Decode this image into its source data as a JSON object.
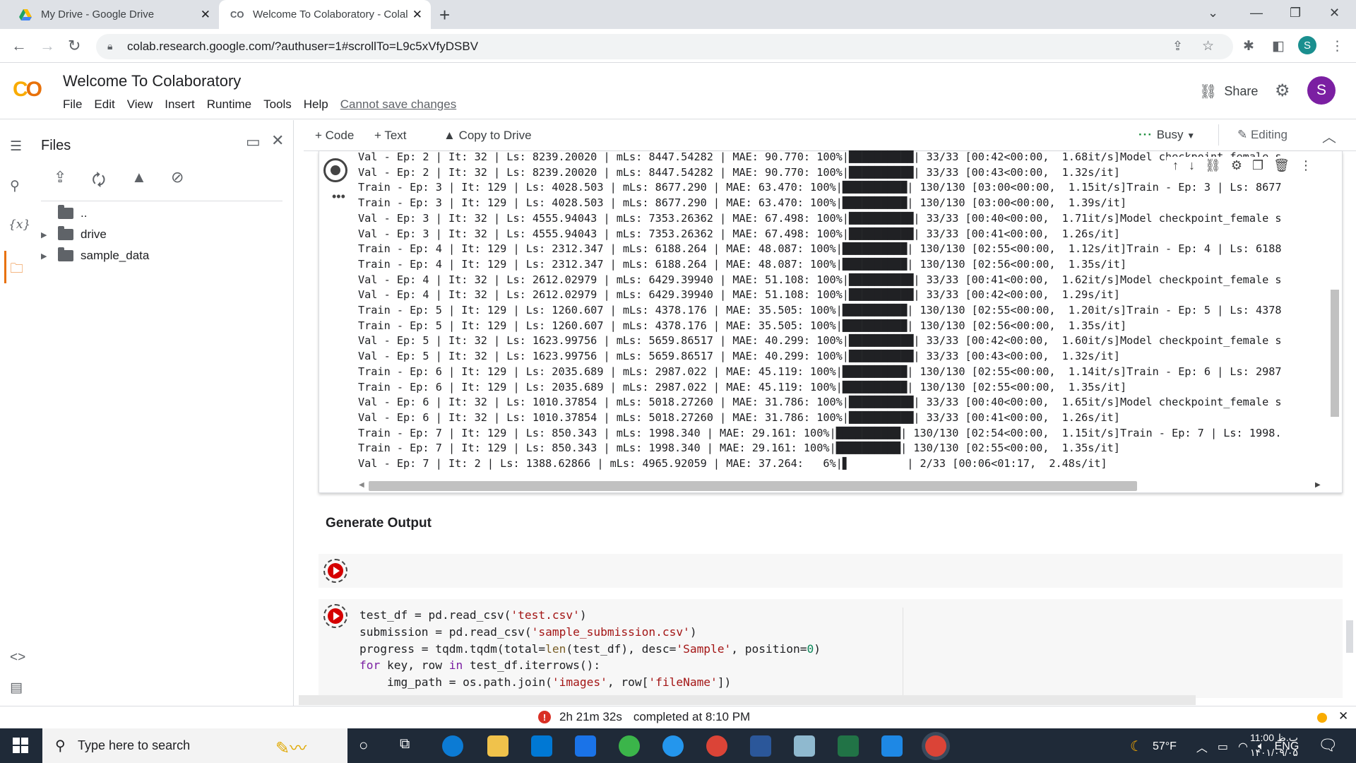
{
  "browser": {
    "tabs": [
      {
        "title": "My Drive - Google Drive",
        "icon": "google-drive-icon"
      },
      {
        "title": "Welcome To Colaboratory - Colal",
        "icon": "colab-icon"
      }
    ],
    "url": "colab.research.google.com/?authuser=1#scrollTo=L9c5xVfyDSBV",
    "profile_initial": "S"
  },
  "colab": {
    "logo": "CO",
    "title": "Welcome To Colaboratory",
    "menu": [
      "File",
      "Edit",
      "View",
      "Insert",
      "Runtime",
      "Tools",
      "Help"
    ],
    "cannot_save": "Cannot save changes",
    "share_label": "Share",
    "avatar_initial": "S"
  },
  "files": {
    "title": "Files",
    "parent": "..",
    "items": [
      "drive",
      "sample_data"
    ]
  },
  "toolbar": {
    "code": "+ Code",
    "text": "+ Text",
    "copy": "Copy to Drive",
    "busy": "Busy",
    "editing": "Editing"
  },
  "output": {
    "lines": [
      "Val - Ep: 2 | It: 32 | Ls: 8239.20020 | mLs: 8447.54282 | MAE: 90.770: 100%|██████████| 33/33 [00:42<00:00,  1.68it/s]Model checkpoint_female s",
      "Val - Ep: 2 | It: 32 | Ls: 8239.20020 | mLs: 8447.54282 | MAE: 90.770: 100%|██████████| 33/33 [00:43<00:00,  1.32s/it]",
      "Train - Ep: 3 | It: 129 | Ls: 4028.503 | mLs: 8677.290 | MAE: 63.470: 100%|██████████| 130/130 [03:00<00:00,  1.15it/s]Train - Ep: 3 | Ls: 8677",
      "Train - Ep: 3 | It: 129 | Ls: 4028.503 | mLs: 8677.290 | MAE: 63.470: 100%|██████████| 130/130 [03:00<00:00,  1.39s/it]",
      "Val - Ep: 3 | It: 32 | Ls: 4555.94043 | mLs: 7353.26362 | MAE: 67.498: 100%|██████████| 33/33 [00:40<00:00,  1.71it/s]Model checkpoint_female s",
      "Val - Ep: 3 | It: 32 | Ls: 4555.94043 | mLs: 7353.26362 | MAE: 67.498: 100%|██████████| 33/33 [00:41<00:00,  1.26s/it]",
      "Train - Ep: 4 | It: 129 | Ls: 2312.347 | mLs: 6188.264 | MAE: 48.087: 100%|██████████| 130/130 [02:55<00:00,  1.12s/it]Train - Ep: 4 | Ls: 6188",
      "Train - Ep: 4 | It: 129 | Ls: 2312.347 | mLs: 6188.264 | MAE: 48.087: 100%|██████████| 130/130 [02:56<00:00,  1.35s/it]",
      "Val - Ep: 4 | It: 32 | Ls: 2612.02979 | mLs: 6429.39940 | MAE: 51.108: 100%|██████████| 33/33 [00:41<00:00,  1.62it/s]Model checkpoint_female s",
      "Val - Ep: 4 | It: 32 | Ls: 2612.02979 | mLs: 6429.39940 | MAE: 51.108: 100%|██████████| 33/33 [00:42<00:00,  1.29s/it]",
      "Train - Ep: 5 | It: 129 | Ls: 1260.607 | mLs: 4378.176 | MAE: 35.505: 100%|██████████| 130/130 [02:55<00:00,  1.20it/s]Train - Ep: 5 | Ls: 4378",
      "Train - Ep: 5 | It: 129 | Ls: 1260.607 | mLs: 4378.176 | MAE: 35.505: 100%|██████████| 130/130 [02:56<00:00,  1.35s/it]",
      "Val - Ep: 5 | It: 32 | Ls: 1623.99756 | mLs: 5659.86517 | MAE: 40.299: 100%|██████████| 33/33 [00:42<00:00,  1.60it/s]Model checkpoint_female s",
      "Val - Ep: 5 | It: 32 | Ls: 1623.99756 | mLs: 5659.86517 | MAE: 40.299: 100%|██████████| 33/33 [00:43<00:00,  1.32s/it]",
      "Train - Ep: 6 | It: 129 | Ls: 2035.689 | mLs: 2987.022 | MAE: 45.119: 100%|██████████| 130/130 [02:55<00:00,  1.14it/s]Train - Ep: 6 | Ls: 2987",
      "Train - Ep: 6 | It: 129 | Ls: 2035.689 | mLs: 2987.022 | MAE: 45.119: 100%|██████████| 130/130 [02:55<00:00,  1.35s/it]",
      "Val - Ep: 6 | It: 32 | Ls: 1010.37854 | mLs: 5018.27260 | MAE: 31.786: 100%|██████████| 33/33 [00:40<00:00,  1.65it/s]Model checkpoint_female s",
      "Val - Ep: 6 | It: 32 | Ls: 1010.37854 | mLs: 5018.27260 | MAE: 31.786: 100%|██████████| 33/33 [00:41<00:00,  1.26s/it]",
      "Train - Ep: 7 | It: 129 | Ls: 850.343 | mLs: 1998.340 | MAE: 29.161: 100%|██████████| 130/130 [02:54<00:00,  1.15it/s]Train - Ep: 7 | Ls: 1998.",
      "Train - Ep: 7 | It: 129 | Ls: 850.343 | mLs: 1998.340 | MAE: 29.161: 100%|██████████| 130/130 [02:55<00:00,  1.35s/it]",
      "Val - Ep: 7 | It: 2 | Ls: 1388.62866 | mLs: 4965.92059 | MAE: 37.264:   6%|▋         | 2/33 [00:06<01:17,  2.48s/it]"
    ]
  },
  "section_title": "Generate Output",
  "code_lines": [
    "test_df = pd.read_csv('test.csv')",
    "submission = pd.read_csv('sample_submission.csv')",
    "progress = tqdm.tqdm(total=len(test_df), desc='Sample', position=0)",
    "for key, row in test_df.iterrows():",
    "    img_path = os.path.join('images', row['fileName'])"
  ],
  "status": {
    "elapsed": "2h 21m 32s",
    "completed": "completed at 8:10 PM"
  },
  "taskbar": {
    "search_placeholder": "Type here to search",
    "weather": "57°F",
    "lang": "ENG",
    "time": "11:00 ب.ظ",
    "date": "۱۴۰۱/۰۹/۰۵"
  }
}
